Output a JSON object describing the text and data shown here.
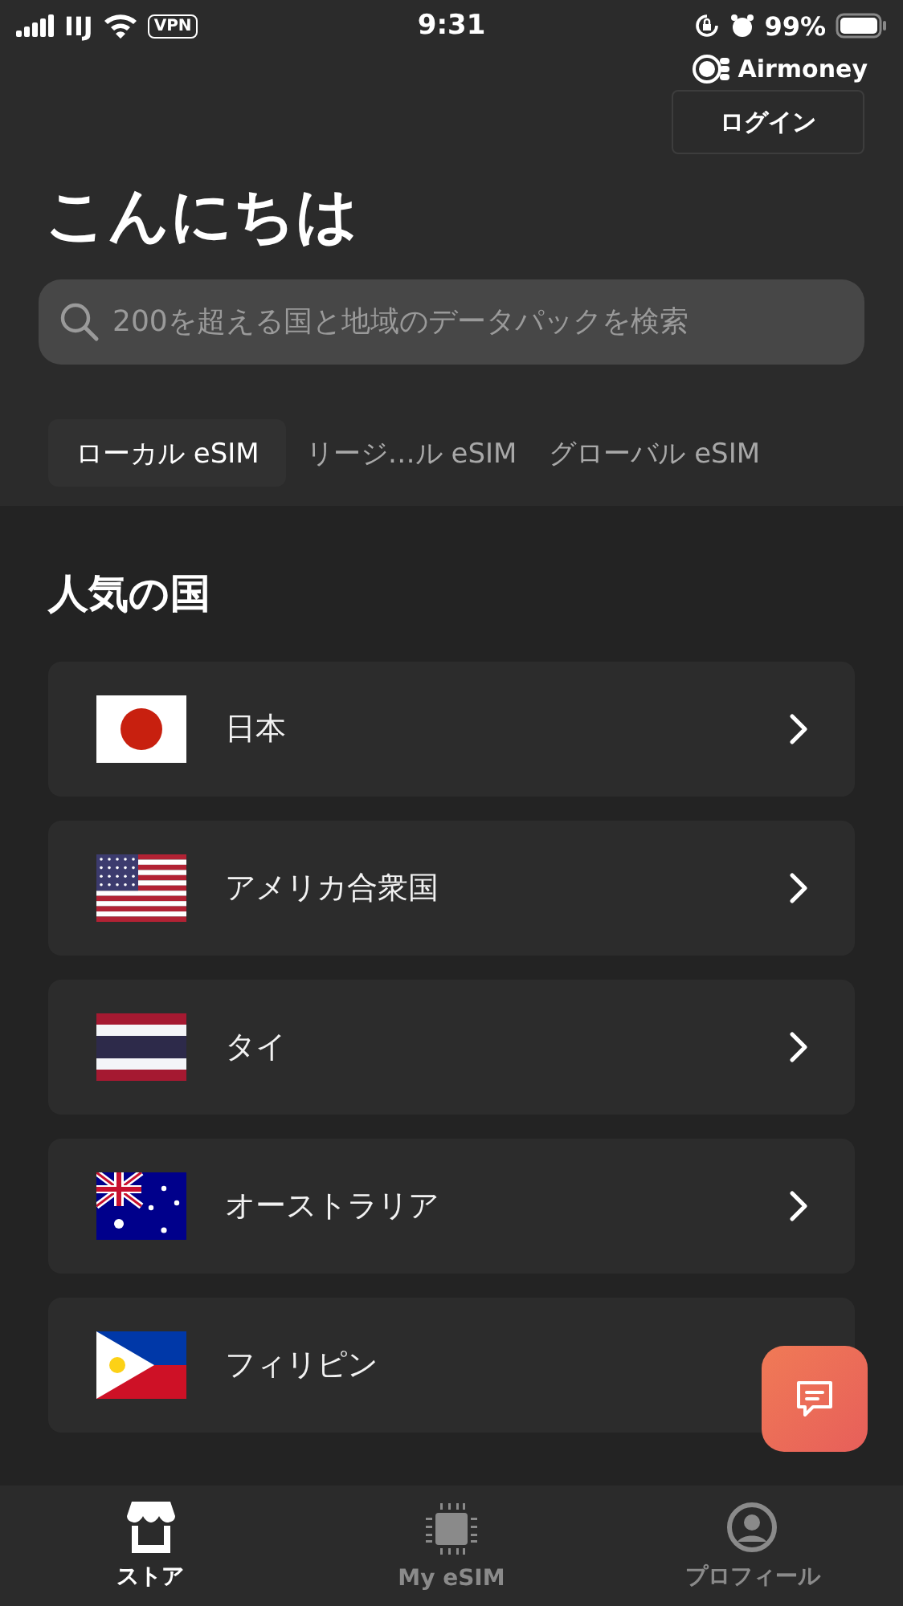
{
  "status_bar": {
    "carrier": "IIJ",
    "vpn": "VPN",
    "time": "9:31",
    "battery": "99%"
  },
  "header": {
    "brand": "Airmoney",
    "login": "ログイン",
    "greeting": "こんにちは"
  },
  "search": {
    "placeholder": "200を超える国と地域のデータパックを検索"
  },
  "tabs": [
    {
      "label": "ローカル eSIM",
      "selected": true
    },
    {
      "label": "リージ…ル eSIM",
      "selected": false
    },
    {
      "label": "グローバル eSIM",
      "selected": false
    }
  ],
  "section_title": "人気の国",
  "countries": [
    {
      "name": "日本",
      "kind": "jp",
      "chevron": true
    },
    {
      "name": "アメリカ合衆国",
      "kind": "us",
      "chevron": true
    },
    {
      "name": "タイ",
      "kind": "th",
      "chevron": true
    },
    {
      "name": "オーストラリア",
      "kind": "au",
      "chevron": true
    },
    {
      "name": "フィリピン",
      "kind": "ph",
      "chevron": false
    }
  ],
  "nav": [
    {
      "label": "ストア",
      "kind": "store",
      "selected": true
    },
    {
      "label": "My eSIM",
      "kind": "chip",
      "selected": false
    },
    {
      "label": "プロフィール",
      "kind": "profile",
      "selected": false
    }
  ]
}
